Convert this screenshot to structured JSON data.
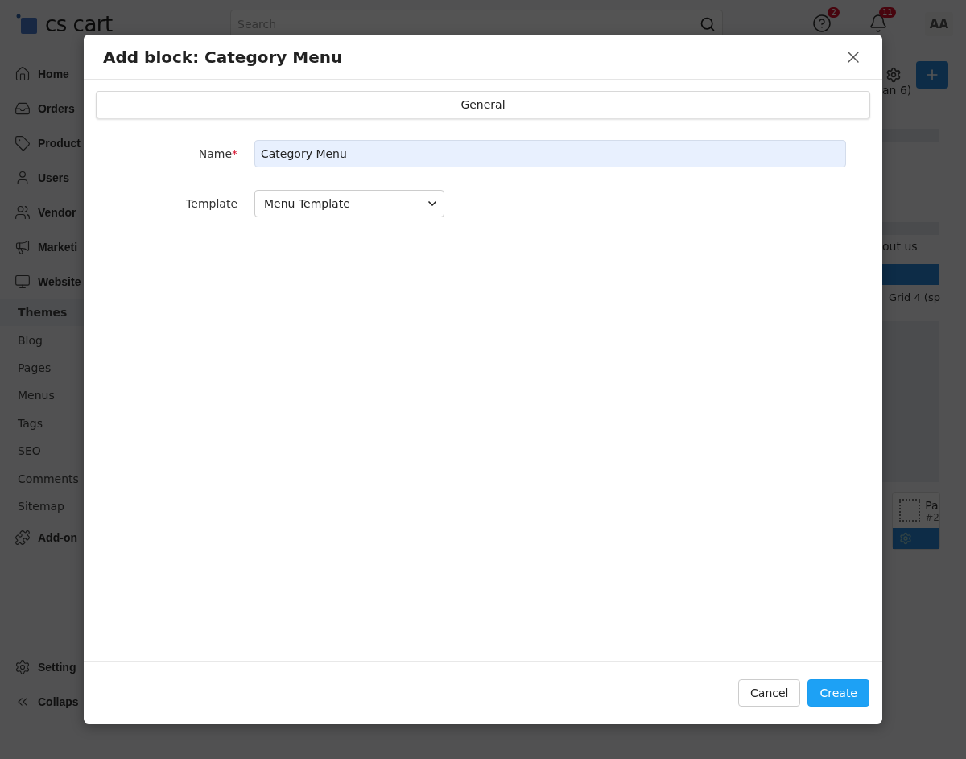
{
  "header": {
    "logo": "cs cart",
    "search": {
      "placeholder": "Search"
    },
    "help_badge": "2",
    "notifications_badge": "11",
    "avatar": "AA"
  },
  "sidebar": {
    "items": [
      {
        "label": "Home"
      },
      {
        "label": "Orders"
      },
      {
        "label": "Product"
      },
      {
        "label": "Users"
      },
      {
        "label": "Vendor"
      },
      {
        "label": "Marketi"
      },
      {
        "label": "Website",
        "children": [
          {
            "label": "Themes",
            "selected": true
          },
          {
            "label": "Blog",
            "selected": false
          },
          {
            "label": "Pages",
            "selected": false
          },
          {
            "label": "Menus",
            "selected": false
          },
          {
            "label": "Tags",
            "selected": false
          },
          {
            "label": "SEO",
            "selected": false
          },
          {
            "label": "Comments",
            "selected": false
          },
          {
            "label": "Sitemap",
            "selected": false
          }
        ]
      },
      {
        "label": "Add-on"
      }
    ],
    "bottom": [
      {
        "label": "Setting"
      },
      {
        "label": "Collaps"
      }
    ]
  },
  "background_fragments": {
    "top": "an 6)",
    "middle": "out us",
    "grid": "Grid 4 (sp",
    "block_title": "Pa",
    "block_id": "#2"
  },
  "dialog": {
    "title": "Add block: Category Menu",
    "tabs": [
      {
        "label": "General",
        "selected": true
      }
    ],
    "fields": [
      {
        "kind": "text",
        "label": "Name",
        "required_mark": "*",
        "value": "Category Menu"
      },
      {
        "kind": "select",
        "label": "Template",
        "value": "Menu Template"
      }
    ],
    "buttons": [
      {
        "label": "Cancel",
        "kind": "secondary"
      },
      {
        "label": "Create",
        "kind": "primary"
      }
    ]
  }
}
